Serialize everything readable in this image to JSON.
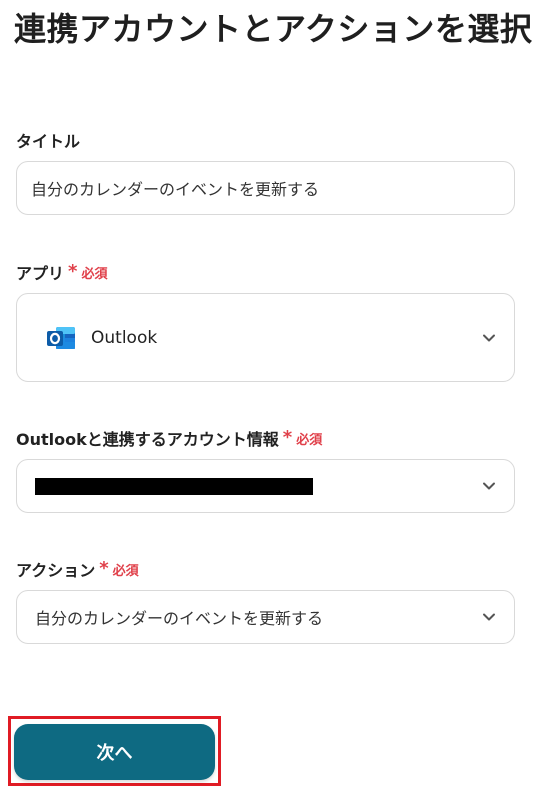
{
  "page": {
    "title": "連携アカウントとアクションを選択"
  },
  "title_field": {
    "label": "タイトル",
    "value": "自分のカレンダーのイベントを更新する"
  },
  "app_field": {
    "label": "アプリ",
    "required_label": "必須",
    "value": "Outlook",
    "icon": "outlook-icon"
  },
  "account_field": {
    "label": "Outlookと連携するアカウント情報",
    "required_label": "必須",
    "value_redacted": true
  },
  "action_field": {
    "label": "アクション",
    "required_label": "必須",
    "value": "自分のカレンダーのイベントを更新する"
  },
  "next_button": {
    "label": "次へ"
  },
  "colors": {
    "required": "#e0404a",
    "primary_button": "#0e6a82",
    "highlight_frame": "#e01b24",
    "border": "#d9d9d9"
  }
}
